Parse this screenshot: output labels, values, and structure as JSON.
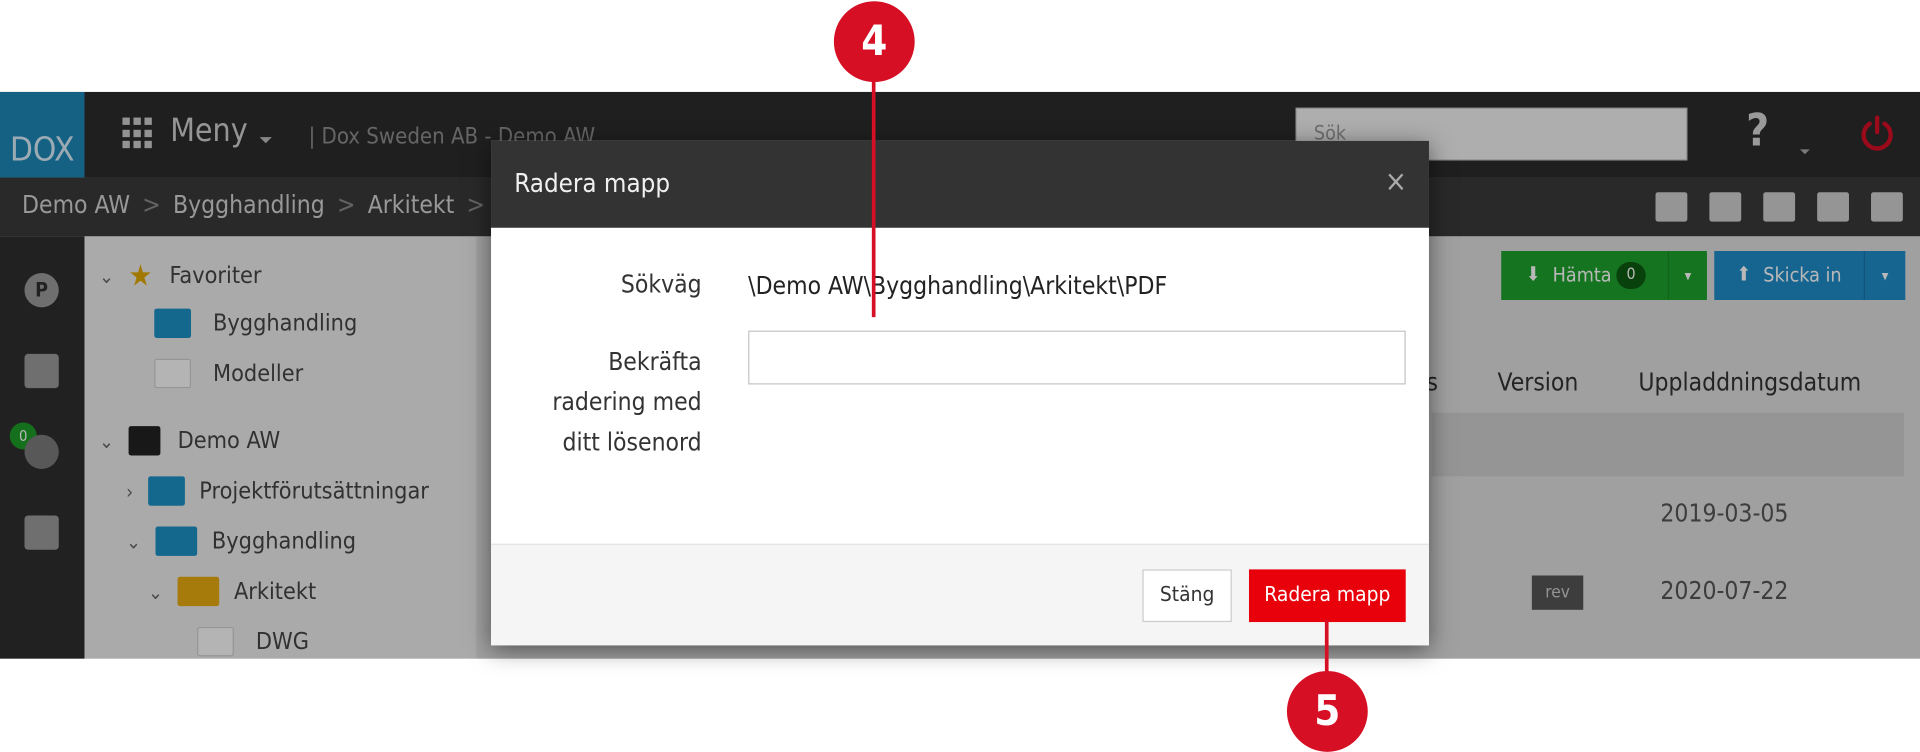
{
  "app": {
    "logo": "DOX",
    "menu_label": "Meny",
    "org_crumb": "| Dox Sweden AB - Demo AW",
    "search_placeholder": "Sök",
    "help_label": "?"
  },
  "breadcrumbs": [
    "Demo AW",
    "Bygghandling",
    "Arkitekt"
  ],
  "sidebar": {
    "badge_count": "0"
  },
  "tree": [
    {
      "label": "Favoriter",
      "kind": "star"
    },
    {
      "label": "Bygghandling",
      "kind": "folder-blue"
    },
    {
      "label": "Modeller",
      "kind": "folder-empty"
    },
    {
      "label": "Demo AW",
      "kind": "archive"
    },
    {
      "label": "Projektförutsättningar",
      "kind": "folder-blue"
    },
    {
      "label": "Bygghandling",
      "kind": "folder-blue-open"
    },
    {
      "label": "Arkitekt",
      "kind": "folder-yellow-open"
    },
    {
      "label": "DWG",
      "kind": "folder-empty"
    }
  ],
  "toolbar": {
    "hamta_label": "Hämta",
    "hamta_count": "0",
    "skicka_label": "Skicka in"
  },
  "table": {
    "headers": [
      "s",
      "Version",
      "Uppladdningsdatum"
    ],
    "rows": [
      {
        "version": "",
        "date": "2019-03-05"
      },
      {
        "version": "rev",
        "date": "2020-07-22"
      }
    ]
  },
  "dialog": {
    "title": "Radera mapp",
    "close_symbol": "×",
    "path_label": "Sökväg",
    "path_value": "\\Demo AW\\Bygghandling\\Arkitekt\\PDF",
    "confirm_label_1": "Bekräfta",
    "confirm_label_2": "radering med",
    "confirm_label_3": "ditt lösenord",
    "close_button": "Stäng",
    "delete_button": "Radera mapp"
  },
  "callouts": [
    "4",
    "5"
  ],
  "colors": {
    "accent_red": "#d60f25",
    "delete_red": "#e8000b",
    "green": "#1ea12b",
    "blue": "#1f8dc9"
  }
}
